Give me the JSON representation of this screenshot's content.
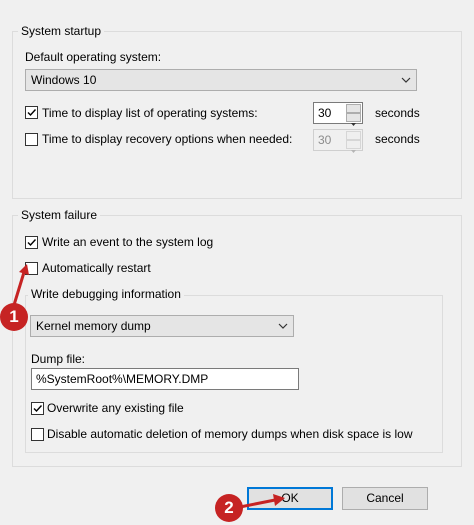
{
  "system_startup": {
    "legend": "System startup",
    "default_os_label": "Default operating system:",
    "default_os_value": "Windows 10",
    "time_display_os_label": "Time to display list of operating systems:",
    "time_display_os_checked": true,
    "time_display_os_value": "30",
    "time_display_os_unit": "seconds",
    "time_recovery_label": "Time to display recovery options when needed:",
    "time_recovery_checked": false,
    "time_recovery_value": "30",
    "time_recovery_unit": "seconds"
  },
  "system_failure": {
    "legend": "System failure",
    "write_event_label": "Write an event to the system log",
    "write_event_checked": true,
    "auto_restart_label": "Automatically restart",
    "auto_restart_checked": false,
    "debug": {
      "legend": "Write debugging information",
      "dump_type_value": "Kernel memory dump",
      "dump_file_label": "Dump file:",
      "dump_file_value": "%SystemRoot%\\MEMORY.DMP",
      "overwrite_label": "Overwrite any existing file",
      "overwrite_checked": true,
      "disable_auto_delete_label": "Disable automatic deletion of memory dumps when disk space is low",
      "disable_auto_delete_checked": false
    }
  },
  "buttons": {
    "ok_label": "OK",
    "cancel_label": "Cancel"
  },
  "annotations": {
    "marker_1": "1",
    "marker_2": "2",
    "color": "#c62323"
  },
  "colors": {
    "focus_border": "#0078d7",
    "window_bg": "#f0f0f0"
  }
}
